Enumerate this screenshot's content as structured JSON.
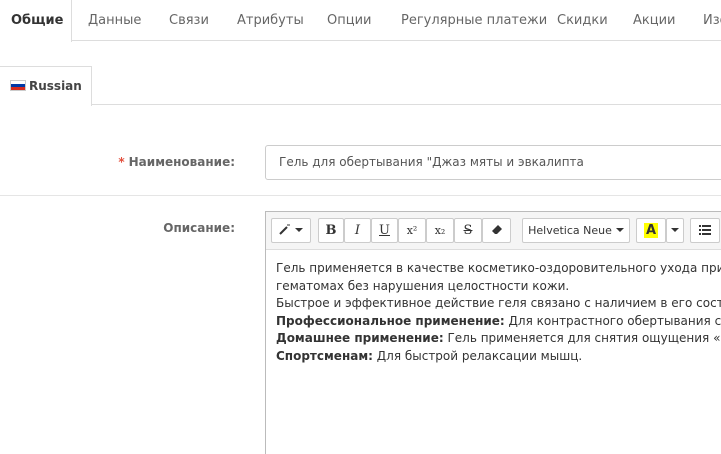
{
  "tabs": [
    {
      "label": "Общие",
      "active": true
    },
    {
      "label": "Данные"
    },
    {
      "label": "Связи"
    },
    {
      "label": "Атрибуты"
    },
    {
      "label": "Опции"
    },
    {
      "label": "Регулярные платежи"
    },
    {
      "label": "Скидки"
    },
    {
      "label": "Акции"
    },
    {
      "label": "Изо"
    }
  ],
  "language_tab": {
    "label": "Russian",
    "flag_colors": [
      "#ffffff",
      "#0039a6",
      "#d52b1e"
    ]
  },
  "name_field": {
    "label": "Наименование:",
    "required_mark": "*",
    "value": "Гель для обертывания \"Джаз мяты и эвкалипта"
  },
  "description": {
    "label": "Описание:",
    "toolbar": {
      "style_icon": "magic-wand-icon",
      "bold": "B",
      "italic": "I",
      "underline": "U",
      "superscript": "x²",
      "subscript": "x₂",
      "strikethrough": "S",
      "eraser_icon": "eraser-icon",
      "font_name": "Helvetica Neue",
      "color_letter": "A",
      "highlight_color": "#ffff00",
      "list_icon": "unordered-list-icon"
    },
    "lines": [
      {
        "bold": "",
        "text": "Гель применяется в качестве косметико-оздоровительного ухода при хрони"
      },
      {
        "bold": "",
        "text": "гематомах без нарушения целостности кожи."
      },
      {
        "bold": "",
        "text": "Быстрое и эффективное действие геля связано с наличием в его составе нат"
      },
      {
        "bold": "Профессиональное применение:",
        "text": " Для контрастного обертывания стоп и н"
      },
      {
        "bold": "Домашнее применение:",
        "text": " Гель применяется для снятия ощущения «гудящ"
      },
      {
        "bold": "Спортсменам:",
        "text": " Для быстрой релаксации мышц."
      }
    ]
  }
}
